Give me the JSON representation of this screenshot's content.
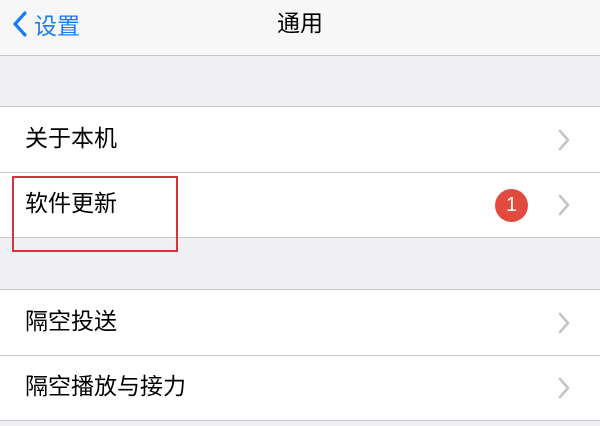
{
  "navbar": {
    "back_label": "设置",
    "title": "通用"
  },
  "groups": [
    {
      "rows": [
        {
          "label": "关于本机"
        },
        {
          "label": "软件更新",
          "badge": "1"
        }
      ]
    },
    {
      "rows": [
        {
          "label": "隔空投送"
        },
        {
          "label": "隔空播放与接力"
        }
      ]
    }
  ],
  "colors": {
    "accent": "#1a7cf5",
    "badge": "#e04a3f",
    "highlight": "#d8323a",
    "background": "#efeff4"
  },
  "icons": {
    "back": "chevron-left-icon",
    "row": "chevron-right-icon"
  }
}
